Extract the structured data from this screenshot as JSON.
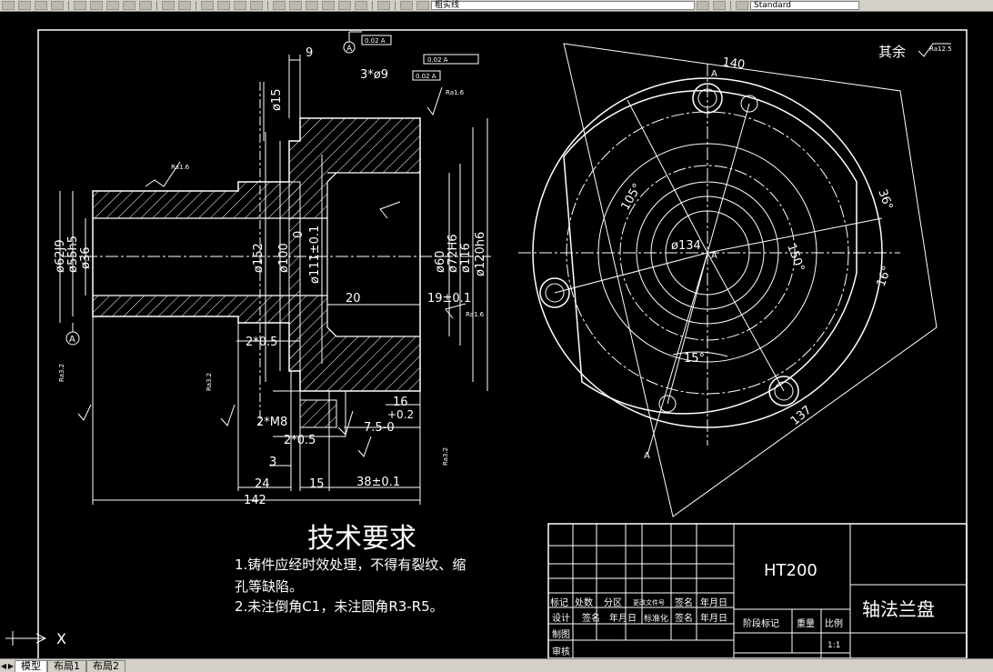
{
  "toolbar": {
    "layer_combo": "粗实线",
    "style_combo": "Standard"
  },
  "drawing": {
    "section_view": {
      "dims": {
        "d9": "9",
        "d15": "ø15",
        "holes": "3*ø9",
        "d6219": "ø62J9",
        "d55h5": "ø55h5",
        "d36": "ø36",
        "d152": "ø152",
        "d100": "ø100",
        "d111": "ø111±0.1",
        "d60": "ø60",
        "d72": "ø72H6",
        "d116": "ø116",
        "d120": "ø120h6",
        "d20": "20",
        "d19": "19±0.1",
        "chamfer1": "2*0.5",
        "thread": "2*M8",
        "chamfer2": "2*0.5",
        "d16": "16",
        "tol1": "+0.2",
        "tol2": "7.5-0",
        "d3": "3",
        "d24": "24",
        "d15b": "15",
        "d38": "38±0.1",
        "d142": "142",
        "datum": "A",
        "zero": "0",
        "gdt1": "0.02 A",
        "gdt2": "0.02 A",
        "gdt3": "0.02 A",
        "rough": "Ra1.6",
        "rough2": "Ra3.2"
      }
    },
    "plan_view": {
      "dims": {
        "d140": "140",
        "d105": "105°",
        "d134": "ø134",
        "d150": "150°",
        "d36deg": "36°",
        "d16deg": "16°",
        "d15deg": "15°",
        "d137": "137",
        "markA": "A"
      }
    },
    "rest_roughness": "其余",
    "rest_ra": "Ra12.5",
    "tech_requirements": {
      "title": "技术要求",
      "line1": "1.铸件应经时效处理，不得有裂纹、缩",
      "line2": "孔等缺陷。",
      "line3": "2.未注倒角C1，未注圆角R3-R5。"
    },
    "title_block": {
      "material": "HT200",
      "part_name": "轴法兰盘",
      "labels": {
        "mark": "标记",
        "count": "处数",
        "zone": "分区",
        "change_doc": "更改文件号",
        "sign": "签名",
        "date": "年月日",
        "design": "设计",
        "sign2": "签名",
        "date2": "年月日",
        "standardize": "标准化",
        "sign3": "签名",
        "date3": "年月日",
        "draw": "制图",
        "review": "审核",
        "stage": "阶段标记",
        "weight": "重量",
        "scale": "比例",
        "scale_value": "1:1"
      }
    }
  },
  "status": {
    "tab_model": "模型",
    "tab_layout1": "布局1",
    "tab_layout2": "布局2",
    "ucs_x": "X"
  },
  "colors": {
    "line": "#ffffff",
    "background": "#000000"
  }
}
